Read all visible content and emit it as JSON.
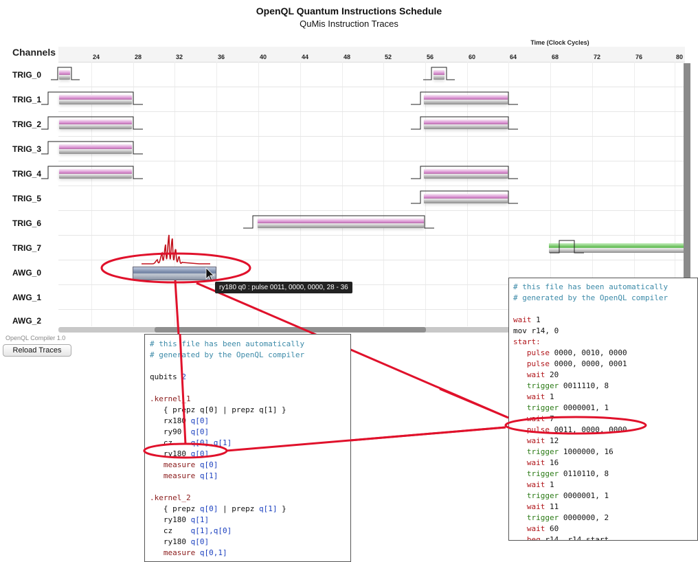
{
  "header": {
    "title": "OpenQL Quantum Instructions Schedule",
    "subtitle": "QuMis Instruction Traces"
  },
  "timeline": {
    "channels_label": "Channels",
    "time_label": "Time (Clock Cycles)",
    "ticks": [
      "24",
      "28",
      "32",
      "36",
      "40",
      "44",
      "48",
      "52",
      "56",
      "60",
      "64",
      "68",
      "72",
      "76",
      "80"
    ],
    "channels": [
      "TRIG_0",
      "TRIG_1",
      "TRIG_2",
      "TRIG_3",
      "TRIG_4",
      "TRIG_5",
      "TRIG_6",
      "TRIG_7",
      "AWG_0",
      "AWG_1",
      "AWG_2"
    ]
  },
  "tooltip": "ry180 q0 : pulse 0011, 0000, 0000, 28 - 36",
  "footer": {
    "version": "OpenQL Compiler 1.0",
    "reload_label": "Reload Traces"
  },
  "openql_code": {
    "line_01": "# this file has been automatically",
    "line_02": "# generated by the OpenQL compiler",
    "line_04a": "qubits ",
    "line_04b": "2",
    "line_06": ".kernel_1",
    "line_07": "   { prepz q[0] | prepz q[1] }",
    "line_08a": "   rx180 ",
    "line_08b": "q[0]",
    "line_09a": "   ry90  ",
    "line_09b": "q[0]",
    "line_10a": "   cz    ",
    "line_10b": "q[0],q[1]",
    "line_11a": "   ry180 ",
    "line_11b": "q[0]",
    "line_12a": "   measure ",
    "line_12b": "q[0]",
    "line_13a": "   measure ",
    "line_13b": "q[1]",
    "line_15": ".kernel_2",
    "line_16a": "   { prepz ",
    "line_16b": "q[0]",
    "line_16c": " | prepz ",
    "line_16d": "q[1]",
    "line_16e": " }",
    "line_17a": "   ry180 ",
    "line_17b": "q[1]",
    "line_18a": "   cz    ",
    "line_18b": "q[1],q[0]",
    "line_19a": "   ry180 ",
    "line_19b": "q[0]",
    "line_20a": "   measure ",
    "line_20b": "q[0,1]",
    "line_21": "   …"
  },
  "qumis_code": {
    "line_01": "# this file has been automatically",
    "line_02": "# generated by the OpenQL compiler",
    "line_04a": "wait ",
    "line_04b": "1",
    "line_05": "mov r14, 0",
    "line_06": "start:",
    "line_07a": "   pulse ",
    "line_07b": "0000, 0010, 0000",
    "line_08a": "   pulse ",
    "line_08b": "0000, 0000, 0001",
    "line_09a": "   wait ",
    "line_09b": "20",
    "line_10a": "   trigger ",
    "line_10b": "0011110, 8",
    "line_11a": "   wait ",
    "line_11b": "1",
    "line_12a": "   trigger ",
    "line_12b": "0000001, 1",
    "line_13a": "   wait ",
    "line_13b": "7",
    "line_14a": "   pulse ",
    "line_14b": "0011, 0000, 0000",
    "line_15a": "   wait ",
    "line_15b": "12",
    "line_16a": "   trigger ",
    "line_16b": "1000000, 16",
    "line_17a": "   wait ",
    "line_17b": "16",
    "line_18a": "   trigger ",
    "line_18b": "0110110, 8",
    "line_19a": "   wait ",
    "line_19b": "1",
    "line_20a": "   trigger ",
    "line_20b": "0000001, 1",
    "line_21a": "   wait ",
    "line_21b": "11",
    "line_22a": "   trigger ",
    "line_22b": "0000000, 2",
    "line_23a": "   wait ",
    "line_23b": "60",
    "line_24a": "   beq ",
    "line_24b": "r14, r14 start"
  },
  "colors": {
    "highlight": "#e0112b",
    "trigger_pulse": "#c77cc0",
    "trig7_pulse": "#58b84a",
    "awg_pulse": "#6d7fa0"
  }
}
